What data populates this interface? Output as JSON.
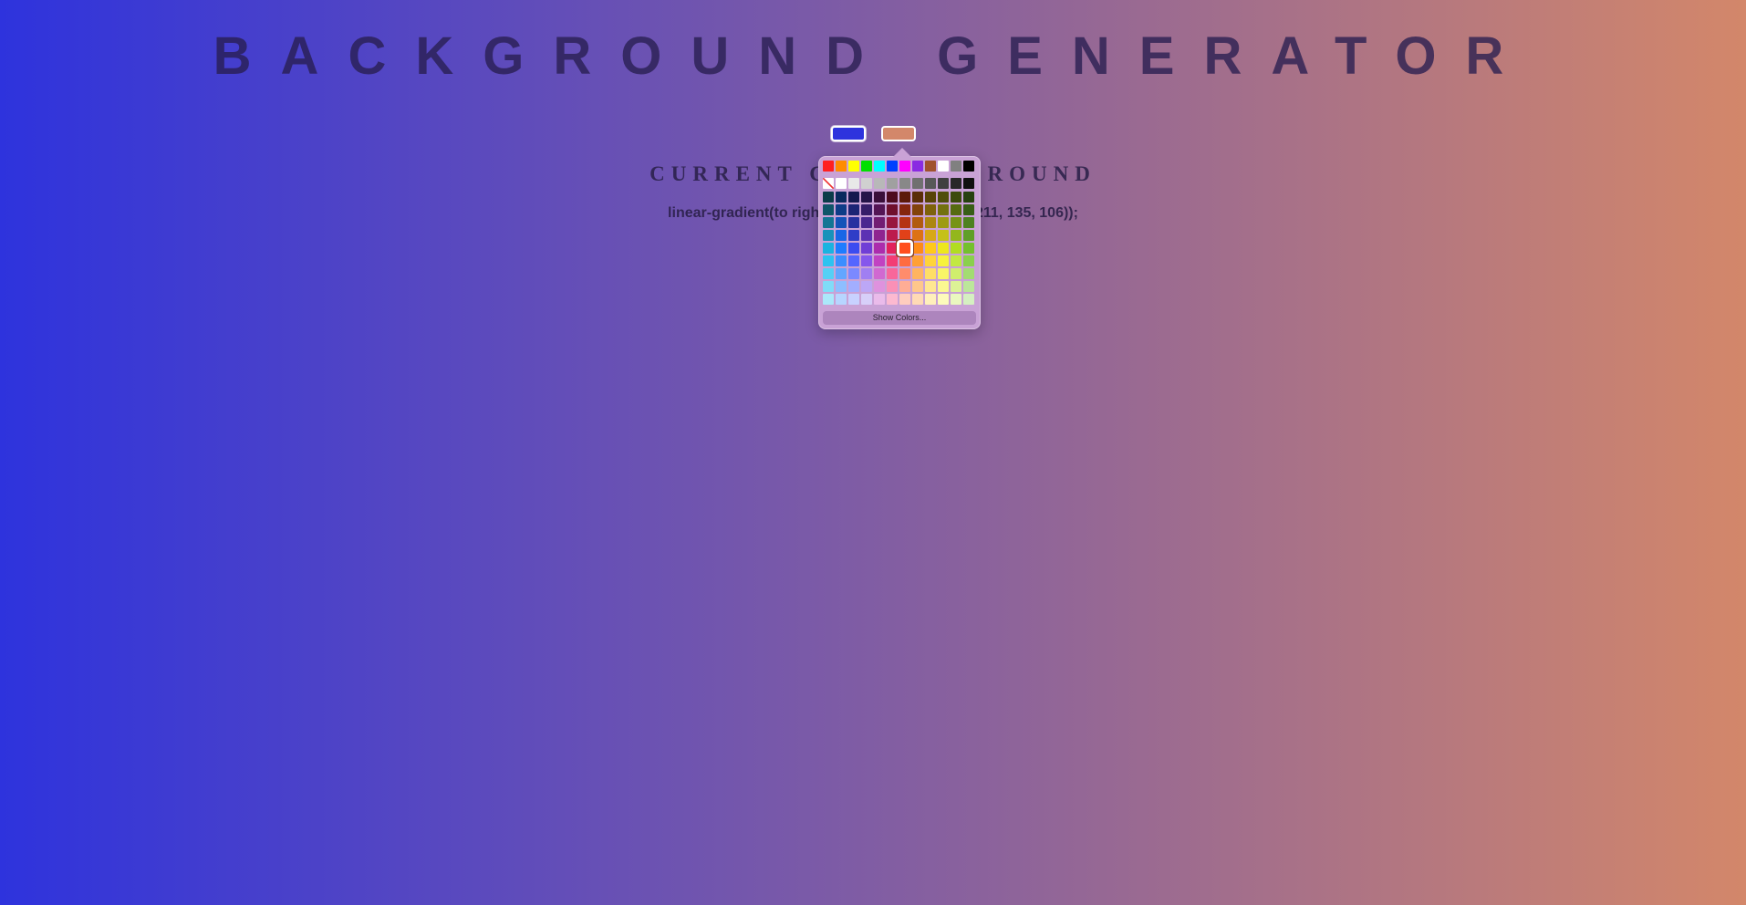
{
  "page": {
    "title": "BACKGROUND GENERATOR",
    "subtitle": "CURRENT CSS BACKGROUND",
    "css_text": "linear-gradient(to right, rgb(46, 51, 221), rgb(211, 135, 106));"
  },
  "colors": {
    "color1": "#2e33dd",
    "color2": "#d3876a"
  },
  "picker": {
    "show_colors_label": "Show Colors...",
    "basic_colors": [
      "#ff2020",
      "#ff8c00",
      "#ffff00",
      "#00e000",
      "#00ffff",
      "#0040ff",
      "#ff00ff",
      "#8a2be2",
      "#a0522d",
      "#ffffff",
      "#808080",
      "#000000"
    ],
    "gray_colors": [
      "none",
      "#ffffff",
      "#e8e8e8",
      "#d0d0d0",
      "#b8b8b8",
      "#a0a0a0",
      "#888888",
      "#707070",
      "#585858",
      "#404040",
      "#282828",
      "#101010"
    ],
    "grid": [
      [
        "#0b3c49",
        "#0a2a5e",
        "#14194f",
        "#251448",
        "#3a0f3a",
        "#4d0b1f",
        "#5c1a0a",
        "#5a2e08",
        "#574408",
        "#4f4e0a",
        "#3c4a0c",
        "#26410f"
      ],
      [
        "#0e5568",
        "#0e3c87",
        "#1c2475",
        "#361d69",
        "#541555",
        "#6f102d",
        "#85250e",
        "#82420b",
        "#7e620c",
        "#73710e",
        "#566b11",
        "#385e16"
      ],
      [
        "#137594",
        "#1453b9",
        "#2631a0",
        "#4a288f",
        "#731d73",
        "#97163e",
        "#b53414",
        "#b15b10",
        "#ac8611",
        "#9e9b13",
        "#769317",
        "#4d811f"
      ],
      [
        "#1792ba",
        "#1966e6",
        "#2f3dc7",
        "#5c32b3",
        "#8f2490",
        "#bc1b4d",
        "#e14119",
        "#dd7214",
        "#d7a816",
        "#c5c118",
        "#93b71d",
        "#609f27"
      ],
      [
        "#1ab3e0",
        "#1e7cff",
        "#3b4cf0",
        "#703ed6",
        "#ac2cad",
        "#e2215c",
        "#ff4f1e",
        "#ff8a18",
        "#ffc91a",
        "#ede71c",
        "#b1dc23",
        "#74c02e"
      ],
      [
        "#2cc3f0",
        "#3b8eff",
        "#5566ff",
        "#8557ec",
        "#c142c2",
        "#f33d74",
        "#ff6b40",
        "#ffa035",
        "#ffd43a",
        "#f7f23c",
        "#c2e843",
        "#8ad04c"
      ],
      [
        "#55d0f5",
        "#63a6ff",
        "#7b89ff",
        "#a07ff2",
        "#d169d1",
        "#f8679a",
        "#ff8c6c",
        "#ffb460",
        "#ffde66",
        "#f9f567",
        "#d0ee6d",
        "#a3dc72"
      ],
      [
        "#80dcf8",
        "#8dbeff",
        "#a2aeff",
        "#bca7f6",
        "#de92de",
        "#fa90b6",
        "#ffad95",
        "#ffc78b",
        "#ffe791",
        "#fbf891",
        "#ddf396",
        "#bce69a"
      ],
      [
        "#abe8fa",
        "#b7d5ff",
        "#c8d1ff",
        "#d7cff9",
        "#eabbea",
        "#fcb9d0",
        "#ffcdbe",
        "#ffdab5",
        "#fff0bb",
        "#fdfbbb",
        "#eaf8bf",
        "#d5efc1"
      ]
    ],
    "selected": {
      "row": 4,
      "col": 6
    }
  }
}
